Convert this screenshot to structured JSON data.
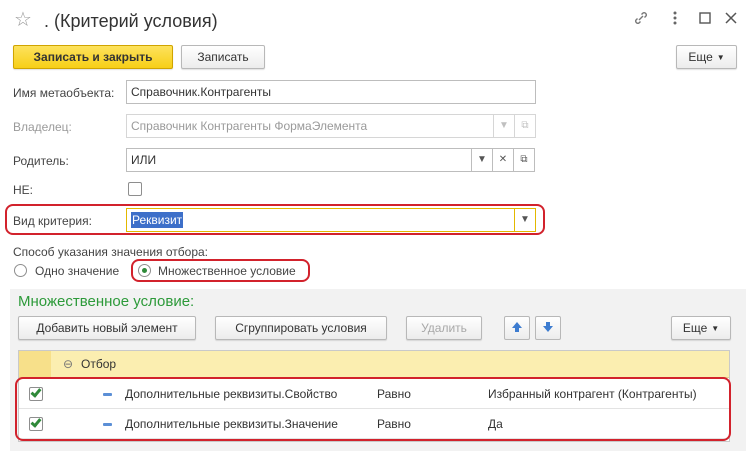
{
  "window": {
    "title": ". (Критерий условия)",
    "icons": [
      "star-icon",
      "link-icon",
      "more-icon",
      "maximize-icon",
      "close-icon"
    ]
  },
  "toolbar": {
    "save_close_label": "Записать и закрыть",
    "save_label": "Записать",
    "more_label": "Еще"
  },
  "form": {
    "metaobject_label": "Имя метаобъекта:",
    "metaobject_value": "Справочник.Контрагенты",
    "owner_label": "Владелец:",
    "owner_value": "Справочник Контрагенты ФормаЭлемента",
    "parent_label": "Родитель:",
    "parent_value": "ИЛИ",
    "not_label": "НЕ:",
    "not_checked": false,
    "criterion_label": "Вид критерия:",
    "criterion_value": "Реквизит",
    "mode_label": "Способ указания значения отбора:",
    "mode_options": [
      "Одно значение",
      "Множественное условие"
    ],
    "mode_selected": "Множественное условие"
  },
  "multi": {
    "title": "Множественное условие:",
    "add_label": "Добавить новый элемент",
    "group_label": "Сгруппировать условия",
    "delete_label": "Удалить",
    "more_label": "Еще",
    "group_row_label": "Отбор",
    "rows": [
      {
        "checked": true,
        "field": "Дополнительные реквизиты.Свойство",
        "comparison": "Равно",
        "value": "Избранный контрагент (Контрагенты)"
      },
      {
        "checked": true,
        "field": "Дополнительные реквизиты.Значение",
        "comparison": "Равно",
        "value": "Да"
      }
    ]
  },
  "colors": {
    "accent_yellow": "#f7cf17",
    "highlight_red": "#d2222c",
    "group_title_green": "#2d9a3a",
    "selection_blue": "#3d6fc9",
    "table_header_yellow": "#fbeeb0"
  }
}
